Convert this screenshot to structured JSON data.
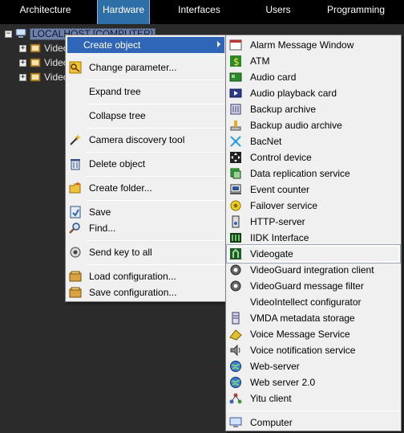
{
  "tabs": [
    {
      "label": "Architecture"
    },
    {
      "label": "Hardware",
      "active": true
    },
    {
      "label": "Interfaces"
    },
    {
      "label": "Users"
    },
    {
      "label": "Programming"
    }
  ],
  "tree": {
    "root": "LOCALHOST [COMPUTER]",
    "children": [
      "Video",
      "Video",
      "Video"
    ]
  },
  "context_menu": {
    "items": [
      {
        "label": "Create object",
        "icon": "none",
        "submenu": true
      },
      {
        "label": "Change parameter...",
        "icon": "key-icon"
      },
      {
        "label": "Expand tree",
        "icon": "none"
      },
      {
        "label": "Collapse tree",
        "icon": "none"
      },
      {
        "label": "Camera discovery tool",
        "icon": "wand-icon"
      },
      {
        "label": "Delete object",
        "icon": "trash-icon"
      },
      {
        "label": "Create folder...",
        "icon": "folder-icon"
      },
      {
        "label": "Save",
        "icon": "save-icon"
      },
      {
        "label": "Find...",
        "icon": "find-icon"
      },
      {
        "label": "Send key to all",
        "icon": "send-key-icon"
      },
      {
        "label": "Load configuration...",
        "icon": "load-config-icon"
      },
      {
        "label": "Save configuration...",
        "icon": "save-config-icon"
      }
    ]
  },
  "submenu": {
    "items": [
      {
        "label": "Alarm Message Window",
        "icon": "alarm-window-icon"
      },
      {
        "label": "ATM",
        "icon": "atm-icon"
      },
      {
        "label": "Audio card",
        "icon": "audio-card-icon"
      },
      {
        "label": "Audio playback card",
        "icon": "audio-playback-icon"
      },
      {
        "label": "Backup archive",
        "icon": "backup-archive-icon"
      },
      {
        "label": "Backup audio archive",
        "icon": "backup-audio-icon"
      },
      {
        "label": "BacNet",
        "icon": "bacnet-icon"
      },
      {
        "label": "Control device",
        "icon": "control-device-icon"
      },
      {
        "label": "Data replication service",
        "icon": "replication-icon"
      },
      {
        "label": "Event counter",
        "icon": "event-counter-icon"
      },
      {
        "label": "Failover service",
        "icon": "failover-icon"
      },
      {
        "label": "HTTP-server",
        "icon": "http-server-icon"
      },
      {
        "label": "IIDK Interface",
        "icon": "iidk-icon"
      },
      {
        "label": "Videogate",
        "icon": "videogate-icon",
        "focused": true
      },
      {
        "label": "VideoGuard integration client",
        "icon": "videoguard-icon"
      },
      {
        "label": "VideoGuard message filter",
        "icon": "videoguard-filter-icon"
      },
      {
        "label": "VideoIntellect configurator",
        "icon": "videointellect-icon"
      },
      {
        "label": "VMDA metadata storage",
        "icon": "vmda-icon"
      },
      {
        "label": "Voice Message Service",
        "icon": "voice-message-icon"
      },
      {
        "label": "Voice notification service",
        "icon": "voice-notification-icon"
      },
      {
        "label": "Web-server",
        "icon": "web-server-icon"
      },
      {
        "label": "Web server 2.0",
        "icon": "web-server2-icon"
      },
      {
        "label": "Yitu client",
        "icon": "yitu-icon"
      },
      {
        "label": "Computer",
        "icon": "computer-icon"
      }
    ]
  },
  "colors": {
    "tab_active": "#2f6fa8",
    "menu_highlight": "#3066b8",
    "menu_bg": "#f0f0f0",
    "tree_bg": "#2b2b2b"
  }
}
